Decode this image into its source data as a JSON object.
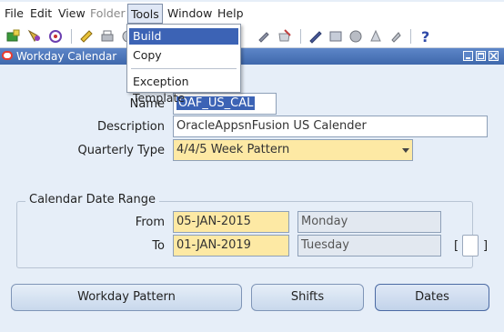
{
  "menubar": {
    "items": [
      {
        "label": "File",
        "enabled": true
      },
      {
        "label": "Edit",
        "enabled": true
      },
      {
        "label": "View",
        "enabled": true
      },
      {
        "label": "Folder",
        "enabled": false
      },
      {
        "label": "Tools",
        "enabled": true,
        "open": true
      },
      {
        "label": "Window",
        "enabled": true
      },
      {
        "label": "Help",
        "enabled": true
      }
    ]
  },
  "tools_menu": {
    "items": [
      {
        "label": "Build",
        "highlighted": true
      },
      {
        "label": "Copy"
      },
      {
        "label": "Exception Template"
      }
    ]
  },
  "toolbar": {
    "icons": [
      "new-icon",
      "find-icon",
      "navigator-icon",
      "save-icon",
      "print-icon",
      "close-form-icon",
      "folder-icon",
      "attachments-icon",
      "edit-field-icon",
      "zoom-icon",
      "translations-icon",
      "window-icon",
      "help-icon"
    ]
  },
  "window": {
    "title": "Workday Calendar",
    "accent": "#3f68ac"
  },
  "form": {
    "name_label": "Name",
    "name_value": "OAF_US_CAL",
    "description_label": "Description",
    "description_value": "OracleAppsnFusion US Calender",
    "quarterly_type_label": "Quarterly Type",
    "quarterly_type_value": "4/4/5 Week Pattern",
    "date_range_title": "Calendar Date Range",
    "from_label": "From",
    "from_date": "05-JAN-2015",
    "from_day": "Monday",
    "to_label": "To",
    "to_date": "01-JAN-2019",
    "to_day": "Tuesday",
    "bracket_open": "[",
    "bracket_close": "]"
  },
  "buttons": {
    "workday_pattern": "Workday Pattern",
    "shifts": "Shifts",
    "dates": "Dates"
  }
}
